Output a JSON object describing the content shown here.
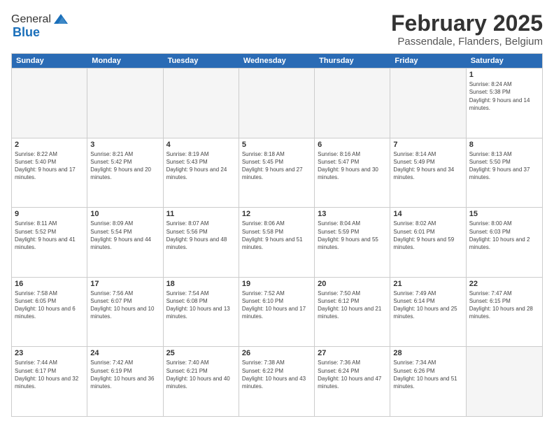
{
  "logo": {
    "general": "General",
    "blue": "Blue"
  },
  "title": "February 2025",
  "subtitle": "Passendale, Flanders, Belgium",
  "days": [
    "Sunday",
    "Monday",
    "Tuesday",
    "Wednesday",
    "Thursday",
    "Friday",
    "Saturday"
  ],
  "weeks": [
    [
      {
        "day": "",
        "empty": true
      },
      {
        "day": "",
        "empty": true
      },
      {
        "day": "",
        "empty": true
      },
      {
        "day": "",
        "empty": true
      },
      {
        "day": "",
        "empty": true
      },
      {
        "day": "",
        "empty": true
      },
      {
        "day": "1",
        "sunrise": "8:24 AM",
        "sunset": "5:38 PM",
        "daylight": "9 hours and 14 minutes."
      }
    ],
    [
      {
        "day": "2",
        "sunrise": "8:22 AM",
        "sunset": "5:40 PM",
        "daylight": "9 hours and 17 minutes."
      },
      {
        "day": "3",
        "sunrise": "8:21 AM",
        "sunset": "5:42 PM",
        "daylight": "9 hours and 20 minutes."
      },
      {
        "day": "4",
        "sunrise": "8:19 AM",
        "sunset": "5:43 PM",
        "daylight": "9 hours and 24 minutes."
      },
      {
        "day": "5",
        "sunrise": "8:18 AM",
        "sunset": "5:45 PM",
        "daylight": "9 hours and 27 minutes."
      },
      {
        "day": "6",
        "sunrise": "8:16 AM",
        "sunset": "5:47 PM",
        "daylight": "9 hours and 30 minutes."
      },
      {
        "day": "7",
        "sunrise": "8:14 AM",
        "sunset": "5:49 PM",
        "daylight": "9 hours and 34 minutes."
      },
      {
        "day": "8",
        "sunrise": "8:13 AM",
        "sunset": "5:50 PM",
        "daylight": "9 hours and 37 minutes."
      }
    ],
    [
      {
        "day": "9",
        "sunrise": "8:11 AM",
        "sunset": "5:52 PM",
        "daylight": "9 hours and 41 minutes."
      },
      {
        "day": "10",
        "sunrise": "8:09 AM",
        "sunset": "5:54 PM",
        "daylight": "9 hours and 44 minutes."
      },
      {
        "day": "11",
        "sunrise": "8:07 AM",
        "sunset": "5:56 PM",
        "daylight": "9 hours and 48 minutes."
      },
      {
        "day": "12",
        "sunrise": "8:06 AM",
        "sunset": "5:58 PM",
        "daylight": "9 hours and 51 minutes."
      },
      {
        "day": "13",
        "sunrise": "8:04 AM",
        "sunset": "5:59 PM",
        "daylight": "9 hours and 55 minutes."
      },
      {
        "day": "14",
        "sunrise": "8:02 AM",
        "sunset": "6:01 PM",
        "daylight": "9 hours and 59 minutes."
      },
      {
        "day": "15",
        "sunrise": "8:00 AM",
        "sunset": "6:03 PM",
        "daylight": "10 hours and 2 minutes."
      }
    ],
    [
      {
        "day": "16",
        "sunrise": "7:58 AM",
        "sunset": "6:05 PM",
        "daylight": "10 hours and 6 minutes."
      },
      {
        "day": "17",
        "sunrise": "7:56 AM",
        "sunset": "6:07 PM",
        "daylight": "10 hours and 10 minutes."
      },
      {
        "day": "18",
        "sunrise": "7:54 AM",
        "sunset": "6:08 PM",
        "daylight": "10 hours and 13 minutes."
      },
      {
        "day": "19",
        "sunrise": "7:52 AM",
        "sunset": "6:10 PM",
        "daylight": "10 hours and 17 minutes."
      },
      {
        "day": "20",
        "sunrise": "7:50 AM",
        "sunset": "6:12 PM",
        "daylight": "10 hours and 21 minutes."
      },
      {
        "day": "21",
        "sunrise": "7:49 AM",
        "sunset": "6:14 PM",
        "daylight": "10 hours and 25 minutes."
      },
      {
        "day": "22",
        "sunrise": "7:47 AM",
        "sunset": "6:15 PM",
        "daylight": "10 hours and 28 minutes."
      }
    ],
    [
      {
        "day": "23",
        "sunrise": "7:44 AM",
        "sunset": "6:17 PM",
        "daylight": "10 hours and 32 minutes."
      },
      {
        "day": "24",
        "sunrise": "7:42 AM",
        "sunset": "6:19 PM",
        "daylight": "10 hours and 36 minutes."
      },
      {
        "day": "25",
        "sunrise": "7:40 AM",
        "sunset": "6:21 PM",
        "daylight": "10 hours and 40 minutes."
      },
      {
        "day": "26",
        "sunrise": "7:38 AM",
        "sunset": "6:22 PM",
        "daylight": "10 hours and 43 minutes."
      },
      {
        "day": "27",
        "sunrise": "7:36 AM",
        "sunset": "6:24 PM",
        "daylight": "10 hours and 47 minutes."
      },
      {
        "day": "28",
        "sunrise": "7:34 AM",
        "sunset": "6:26 PM",
        "daylight": "10 hours and 51 minutes."
      },
      {
        "day": "",
        "empty": true
      }
    ]
  ]
}
